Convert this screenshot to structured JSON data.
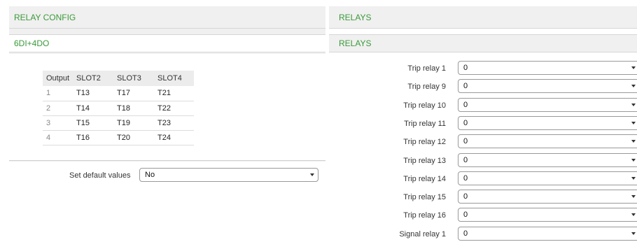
{
  "left": {
    "header": "RELAY CONFIG",
    "subheader": "6DI+4DO",
    "table": {
      "headers": [
        "Output",
        "SLOT2",
        "SLOT3",
        "SLOT4"
      ],
      "rows": [
        [
          "1",
          "T13",
          "T17",
          "T21"
        ],
        [
          "2",
          "T14",
          "T18",
          "T22"
        ],
        [
          "3",
          "T15",
          "T19",
          "T23"
        ],
        [
          "4",
          "T16",
          "T20",
          "T24"
        ]
      ]
    },
    "default_label": "Set default values",
    "default_value": "No"
  },
  "right": {
    "header": "RELAYS",
    "subheader": "RELAYS",
    "relays": [
      {
        "label": "Trip relay 1",
        "value": "0"
      },
      {
        "label": "Trip relay 9",
        "value": "0"
      },
      {
        "label": "Trip relay 10",
        "value": "0"
      },
      {
        "label": "Trip relay 11",
        "value": "0"
      },
      {
        "label": "Trip relay 12",
        "value": "0"
      },
      {
        "label": "Trip relay 13",
        "value": "0"
      },
      {
        "label": "Trip relay 14",
        "value": "0"
      },
      {
        "label": "Trip relay 15",
        "value": "0"
      },
      {
        "label": "Trip relay 16",
        "value": "0"
      },
      {
        "label": "Signal relay 1",
        "value": "0"
      }
    ]
  },
  "colors": {
    "accent": "#3a9a3a",
    "panel_bg": "#f0f0f0"
  },
  "icons": {
    "dropdown": "chevron-down-icon"
  }
}
